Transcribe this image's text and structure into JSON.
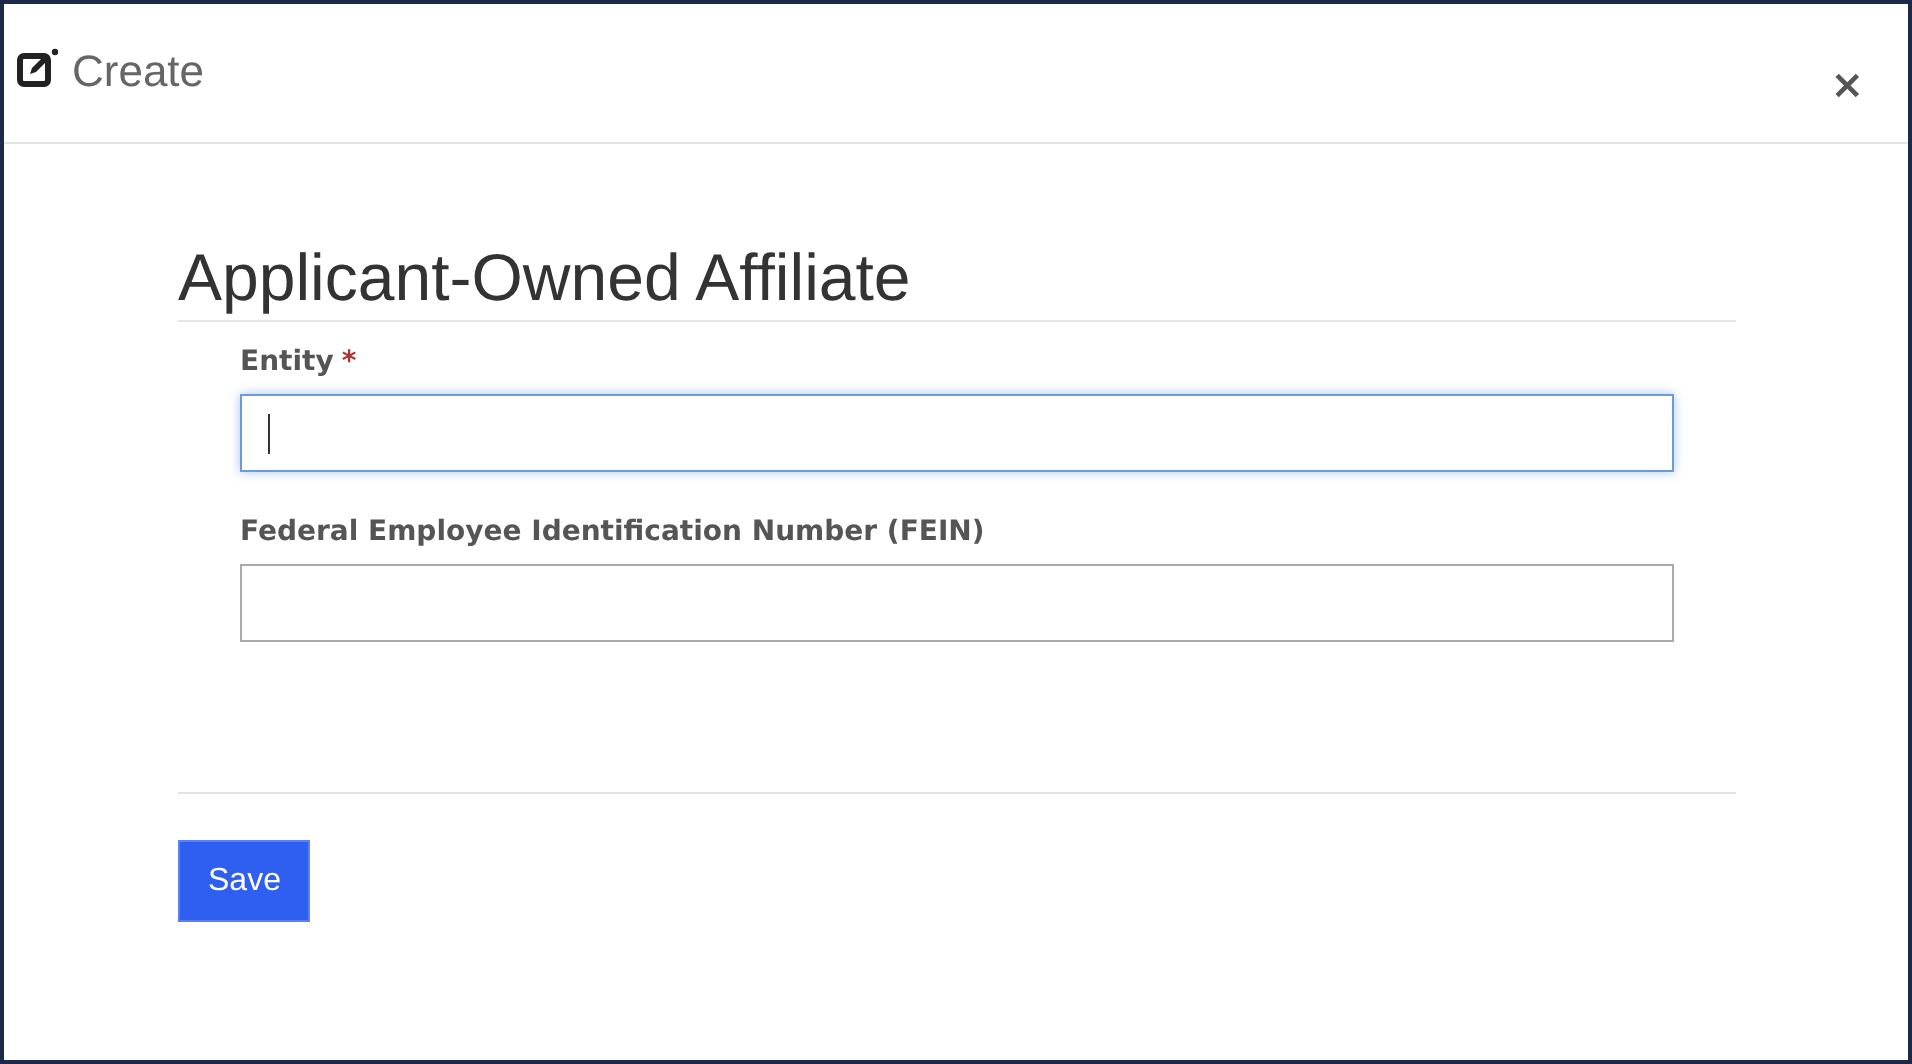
{
  "dialog": {
    "title": "Create",
    "close": "×"
  },
  "form": {
    "heading": "Applicant-Owned Affiliate",
    "fields": [
      {
        "label": "Entity",
        "required_mark": "*",
        "focused": true
      },
      {
        "label": "Federal Employee Identification Number (FEIN)",
        "focused": false
      }
    ]
  },
  "buttons": [
    {
      "label": "Save",
      "kind": "primary"
    }
  ]
}
